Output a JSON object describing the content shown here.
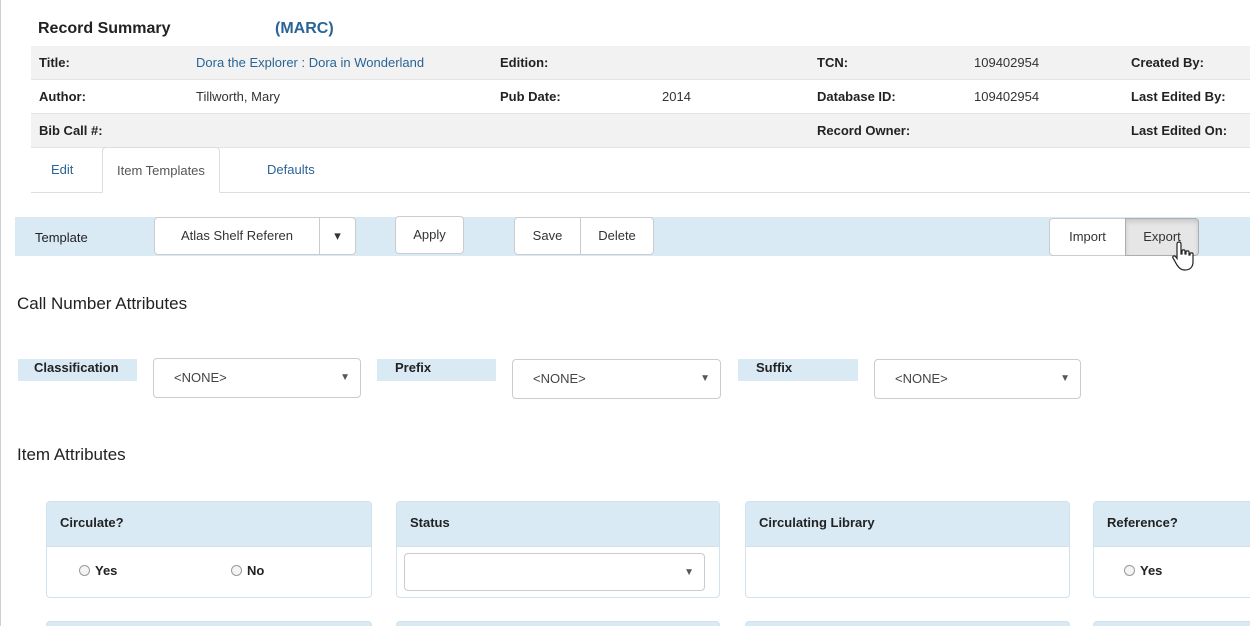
{
  "record_summary": {
    "heading": "Record Summary",
    "marc_link": "(MARC)",
    "rows": [
      {
        "title_lbl": "Title:",
        "title_val": "Dora the Explorer : Dora in Wonderland",
        "ed_lbl": "Edition:",
        "ed_val": "",
        "tcn_lbl": "TCN:",
        "tcn_val": "109402954",
        "c_lbl": "Created By:"
      },
      {
        "title_lbl": "Author:",
        "title_val": "Tillworth, Mary",
        "ed_lbl": "Pub Date:",
        "ed_val": "2014",
        "tcn_lbl": "Database ID:",
        "tcn_val": "109402954",
        "c_lbl": "Last Edited By:"
      },
      {
        "title_lbl": "Bib Call #:",
        "title_val": "",
        "ed_lbl": "",
        "ed_val": "",
        "tcn_lbl": "Record Owner:",
        "tcn_val": "",
        "c_lbl": "Last Edited On:"
      }
    ]
  },
  "tabs": {
    "edit": "Edit",
    "item_templates": "Item Templates",
    "defaults": "Defaults"
  },
  "template_bar": {
    "label": "Template",
    "selected": "Atlas Shelf Referen",
    "caret": "▾",
    "apply": "Apply",
    "save": "Save",
    "delete": "Delete",
    "import": "Import",
    "export": "Export"
  },
  "call_number": {
    "heading": "Call Number Attributes",
    "classification": {
      "label": "Classification",
      "value": "<NONE>"
    },
    "prefix": {
      "label": "Prefix",
      "value": "<NONE>"
    },
    "suffix": {
      "label": "Suffix",
      "value": "<NONE>"
    },
    "arrow": "▼"
  },
  "item_attributes": {
    "heading": "Item Attributes",
    "circulate": {
      "title": "Circulate?",
      "yes": "Yes",
      "no": "No"
    },
    "status": {
      "title": "Status",
      "value": ""
    },
    "circ_lib": {
      "title": "Circulating Library"
    },
    "reference": {
      "title": "Reference?",
      "yes": "Yes"
    }
  }
}
